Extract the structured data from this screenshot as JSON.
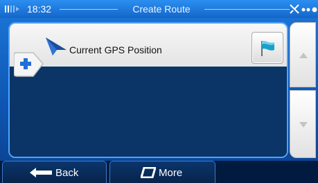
{
  "status_bar": {
    "time": "18:32",
    "title": "Create Route"
  },
  "route": {
    "waypoints": [
      {
        "label": "Current GPS Position",
        "icon": "nav-arrow-icon"
      }
    ],
    "add_icon": "plus-icon",
    "destination_icon": "flag-icon"
  },
  "toolbar": {
    "back_label": "Back",
    "more_label": "More"
  },
  "colors": {
    "accent_blue": "#1466c9",
    "panel_dark": "#0a3566",
    "bottom_bar": "#001b3f",
    "plus_blue": "#1f6fd6"
  }
}
